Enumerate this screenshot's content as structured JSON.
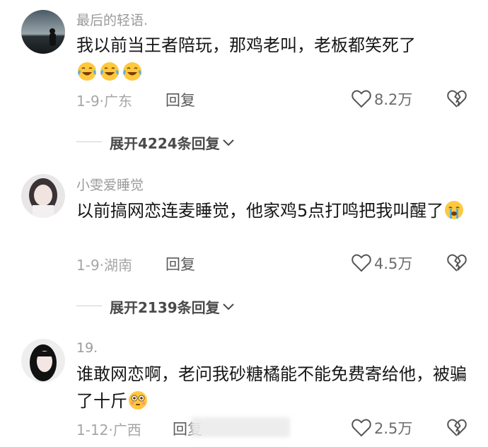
{
  "comments": [
    {
      "username": "最后的轻语.",
      "text": "我以前当王者陪玩，那鸡老叫，老板都笑死了",
      "emoji_count": 3,
      "emoji_icon": "laughing-crying-face",
      "date": "1-9",
      "location": "广东",
      "reply_label": "回复",
      "likes": "8.2万",
      "expand_label": "展开4224条回复"
    },
    {
      "username": "小雯爱睡觉",
      "text": "以前搞网恋连麦睡觉，他家鸡5点打鸣把我叫醒了",
      "emoji_count": 1,
      "emoji_icon": "crying-face",
      "date": "1-9",
      "location": "湖南",
      "reply_label": "回复",
      "likes": "4.5万",
      "expand_label": "展开2139条回复"
    },
    {
      "username": "19.",
      "text": "谁敢网恋啊，老问我砂糖橘能不能免费寄给他，被骗了十斤",
      "emoji_count": 1,
      "emoji_icon": "flushed-face",
      "date": "1-12",
      "location": "广西",
      "reply_label": "回复",
      "likes": "2.5万"
    }
  ],
  "separator": "·",
  "colors": {
    "username": "#9a9a9a",
    "text": "#161616",
    "meta": "#a6a6a6",
    "emoji_yellow": "#ffc83d"
  }
}
